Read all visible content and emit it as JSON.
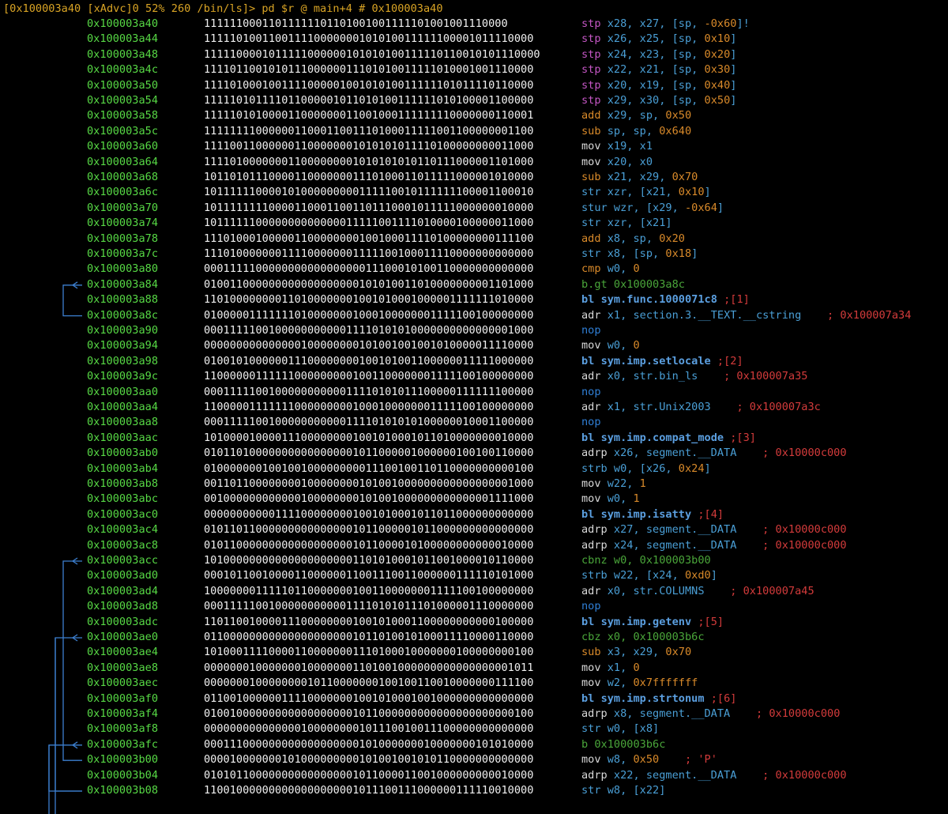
{
  "prompt": "[0x100003a40 [xAdvc]0 52% 260 /bin/ls]> pd $r @ main+4 # 0x100003a40",
  "lines": [
    {
      "addr": "0x100003a40",
      "bits": "11111100011011111101101001001111101001001110000",
      "mn": "stp",
      "mc": "c-stp",
      "ops": [
        [
          "x28, x27, [",
          "reg"
        ],
        [
          "sp",
          "reg"
        ],
        [
          ", ",
          "reg"
        ],
        [
          "-0x60",
          "num"
        ],
        [
          "]!",
          "reg"
        ]
      ]
    },
    {
      "addr": "0x100003a44",
      "bits": "111110100110011110000000101010011111100001011110000",
      "mn": "stp",
      "mc": "c-stp",
      "ops": [
        [
          "x26, x25, [sp, ",
          "reg"
        ],
        [
          "0x10",
          "num"
        ],
        [
          "]",
          "reg"
        ]
      ]
    },
    {
      "addr": "0x100003a48",
      "bits": "111110000101111100000010101010011111011001010111 0000",
      "mn": "stp",
      "mc": "c-stp",
      "ops": [
        [
          "x24, x23, [sp, ",
          "reg"
        ],
        [
          "0x20",
          "num"
        ],
        [
          "]",
          "reg"
        ]
      ]
    },
    {
      "addr": "0x100003a4c",
      "bits": "111101100101011100000011101010011111010001001110000",
      "mn": "stp",
      "mc": "c-stp",
      "ops": [
        [
          "x22, x21, [sp, ",
          "reg"
        ],
        [
          "0x30",
          "num"
        ],
        [
          "]",
          "reg"
        ]
      ]
    },
    {
      "addr": "0x100003a50",
      "bits": "111101000100111100000100101010011111101011110110000",
      "mn": "stp",
      "mc": "c-stp",
      "ops": [
        [
          "x20, x19, [sp, ",
          "reg"
        ],
        [
          "0x40",
          "num"
        ],
        [
          "]",
          "reg"
        ]
      ]
    },
    {
      "addr": "0x100003a54",
      "bits": "111110101111011000001011010100111111010100001100000",
      "mn": "stp",
      "mc": "c-stp",
      "ops": [
        [
          "x29, x30, [sp, ",
          "reg"
        ],
        [
          "0x50",
          "num"
        ],
        [
          "]",
          "reg"
        ]
      ]
    },
    {
      "addr": "0x100003a58",
      "bits": "111110101000011000000011001000111111110000000110001",
      "mn": "add",
      "mc": "c-cmp",
      "ops": [
        [
          "x29, ",
          "reg"
        ],
        [
          "sp",
          "reg"
        ],
        [
          ", ",
          "reg"
        ],
        [
          "0x50",
          "num"
        ]
      ]
    },
    {
      "addr": "0x100003a5c",
      "bits": "111111110000001100011001110100011111001100000001100",
      "mn": "sub",
      "mc": "c-cmp",
      "ops": [
        [
          "sp, sp, ",
          "reg"
        ],
        [
          "0x640",
          "num"
        ]
      ]
    },
    {
      "addr": "0x100003a60",
      "bits": "111100110000001100000001010101011110100000000011000",
      "mn": "mov",
      "mc": "c-mov",
      "ops": [
        [
          "x19, x1",
          "reg"
        ]
      ]
    },
    {
      "addr": "0x100003a64",
      "bits": "111101000000011000000001010101010110111000001101000",
      "mn": "mov",
      "mc": "c-mov",
      "ops": [
        [
          "x20, x0",
          "reg"
        ]
      ]
    },
    {
      "addr": "0x100003a68",
      "bits": "101101011100001100000001110100011011111000001010000",
      "mn": "sub",
      "mc": "c-cmp",
      "ops": [
        [
          "x21, x29, ",
          "reg"
        ],
        [
          "0x70",
          "num"
        ]
      ]
    },
    {
      "addr": "0x100003a6c",
      "bits": "101111110000101000000000111110010111111100001100010",
      "mn": "str",
      "mc": "c-st",
      "ops": [
        [
          "xzr, [x21, ",
          "reg"
        ],
        [
          "0x10",
          "num"
        ],
        [
          "]",
          "reg"
        ]
      ]
    },
    {
      "addr": "0x100003a70",
      "bits": "101111111100001100011001101110001011111000000010000",
      "mn": "stur",
      "mc": "c-st",
      "ops": [
        [
          "wzr, [x29, ",
          "reg"
        ],
        [
          "-0x64",
          "num"
        ],
        [
          "]",
          "reg"
        ]
      ]
    },
    {
      "addr": "0x100003a74",
      "bits": "101111110000000000000011111001111010000100000011000",
      "mn": "str",
      "mc": "c-st",
      "ops": [
        [
          "xzr, [x21]",
          "reg"
        ]
      ]
    },
    {
      "addr": "0x100003a78",
      "bits": "111010001000001100000000100100011110100000000111100",
      "mn": "add",
      "mc": "c-cmp",
      "ops": [
        [
          "x8, sp, ",
          "reg"
        ],
        [
          "0x20",
          "num"
        ]
      ]
    },
    {
      "addr": "0x100003a7c",
      "bits": "111010000000111100000001111100100011110000000000000",
      "mn": "str",
      "mc": "c-st",
      "ops": [
        [
          "x8, [sp, ",
          "reg"
        ],
        [
          "0x18",
          "num"
        ],
        [
          "]",
          "reg"
        ]
      ]
    },
    {
      "addr": "0x100003a80",
      "bits": "000111110000000000000000011100010100110000000000000",
      "mn": "cmp",
      "mc": "c-cmp",
      "ops": [
        [
          "w0, ",
          "reg"
        ],
        [
          "0",
          "num"
        ]
      ]
    },
    {
      "addr": "0x100003a84",
      "bits": "010011000000000000000000101010011010000000001101000",
      "mn": "b.gt",
      "mc": "c-jmp",
      "ops": [
        [
          "0x100003a8c",
          "c-jmp"
        ]
      ]
    },
    {
      "addr": "0x100003a88",
      "bits": "110100000000110100000001001010001000001111111010000",
      "mn": "bl",
      "mc": "c-call",
      "ops": [
        [
          "sym.func.1000071c8",
          "c-call"
        ],
        [
          " ;[1]",
          "ref"
        ]
      ]
    },
    {
      "addr": "0x100003a8c",
      "bits": "010000011111110100000001000100000001111100100000000",
      "mn": "adr",
      "mc": "c-ar",
      "ops": [
        [
          "x1, section.3.__TEXT.__cstring",
          "sym"
        ],
        [
          "    ; 0x100007a34",
          "cmt"
        ]
      ]
    },
    {
      "addr": "0x100003a90",
      "bits": "000111110010000000000011110101010000000000000001000",
      "mn": "nop",
      "mc": "c-nop",
      "ops": []
    },
    {
      "addr": "0x100003a94",
      "bits": "000000000000000100000000101001001001010000011110000",
      "mn": "mov",
      "mc": "c-mov",
      "ops": [
        [
          "w0, ",
          "reg"
        ],
        [
          "0",
          "num"
        ]
      ]
    },
    {
      "addr": "0x100003a98",
      "bits": "010010100000011100000000100101001100000011111000000",
      "mn": "bl",
      "mc": "c-call",
      "ops": [
        [
          "sym.imp.setlocale",
          "c-call"
        ],
        [
          " ;[2]",
          "ref"
        ]
      ]
    },
    {
      "addr": "0x100003a9c",
      "bits": "110000001111110000000001001100000001111100100000000",
      "mn": "adr",
      "mc": "c-ar",
      "ops": [
        [
          "x0, str.bin_ls",
          "sym"
        ],
        [
          "    ; 0x100007a35",
          "cmt"
        ]
      ]
    },
    {
      "addr": "0x100003aa0",
      "bits": "000111110010000000000011110101011100000111111100000",
      "mn": "nop",
      "mc": "c-nop",
      "ops": []
    },
    {
      "addr": "0x100003aa4",
      "bits": "110000011111110000000001000100000001111100100000000",
      "mn": "adr",
      "mc": "c-ar",
      "ops": [
        [
          "x1, str.Unix2003",
          "sym"
        ],
        [
          "    ; 0x100007a3c",
          "cmt"
        ]
      ]
    },
    {
      "addr": "0x100003aa8",
      "bits": "000111110010000000000011110101010100000010001100000",
      "mn": "nop",
      "mc": "c-nop",
      "ops": []
    },
    {
      "addr": "0x100003aac",
      "bits": "101000010000111000000001001010001011010000000010000",
      "mn": "bl",
      "mc": "c-call",
      "ops": [
        [
          "sym.imp.compat_mode",
          "c-call"
        ],
        [
          " ;[3]",
          "ref"
        ]
      ]
    },
    {
      "addr": "0x100003ab0",
      "bits": "010110100000000000000001011000001000000100100110000",
      "mn": "adrp",
      "mc": "c-ar",
      "ops": [
        [
          "x26, segment.__DATA",
          "sym"
        ],
        [
          "    ; 0x10000c000",
          "cmt"
        ]
      ]
    },
    {
      "addr": "0x100003ab4",
      "bits": "010000000100100100000000011100100110110000000000100",
      "mn": "strb",
      "mc": "c-st",
      "ops": [
        [
          "w0, [x26, ",
          "reg"
        ],
        [
          "0x24",
          "num"
        ],
        [
          "]",
          "reg"
        ]
      ]
    },
    {
      "addr": "0x100003ab8",
      "bits": "001101100000000100000000101001000000000000000001000",
      "mn": "mov",
      "mc": "c-mov",
      "ops": [
        [
          "w22, ",
          "reg"
        ],
        [
          "1",
          "num"
        ]
      ]
    },
    {
      "addr": "0x100003abc",
      "bits": "001000000000000100000000101001000000000000001111000",
      "mn": "mov",
      "mc": "c-mov",
      "ops": [
        [
          "w0, ",
          "reg"
        ],
        [
          "1",
          "num"
        ]
      ]
    },
    {
      "addr": "0x100003ac0",
      "bits": "000000000001111000000001001010001011011000000000000",
      "mn": "bl",
      "mc": "c-call",
      "ops": [
        [
          "sym.imp.isatty",
          "c-call"
        ],
        [
          " ;[4]",
          "ref"
        ]
      ]
    },
    {
      "addr": "0x100003ac4",
      "bits": "010110110000000000000001011000001011000000000000000",
      "mn": "adrp",
      "mc": "c-ar",
      "ops": [
        [
          "x27, segment.__DATA",
          "sym"
        ],
        [
          "    ; 0x10000c000",
          "cmt"
        ]
      ]
    },
    {
      "addr": "0x100003ac8",
      "bits": "010110000000000000000001011000010100000000000010000",
      "mn": "adrp",
      "mc": "c-ar",
      "ops": [
        [
          "x24, segment.__DATA",
          "sym"
        ],
        [
          "    ; 0x10000c000",
          "cmt"
        ]
      ]
    },
    {
      "addr": "0x100003acc",
      "bits": "101000000000000000000001101010001011001000010110000",
      "mn": "cbnz",
      "mc": "c-jmp",
      "ops": [
        [
          "w0, 0x100003b00",
          "c-jmp"
        ]
      ]
    },
    {
      "addr": "0x100003ad0",
      "bits": "000101100100001100000011001110011000000111110101000",
      "mn": "strb",
      "mc": "c-st",
      "ops": [
        [
          "w22, [x24, ",
          "reg"
        ],
        [
          "0xd0",
          "num"
        ],
        [
          "]",
          "reg"
        ]
      ]
    },
    {
      "addr": "0x100003ad4",
      "bits": "100000001111101100000001001100000001111100100000000",
      "mn": "adr",
      "mc": "c-ar",
      "ops": [
        [
          "x0, str.COLUMNS",
          "sym"
        ],
        [
          "    ; 0x100007a45",
          "cmt"
        ]
      ]
    },
    {
      "addr": "0x100003ad8",
      "bits": "000111110010000000000011110101011101000001110000000",
      "mn": "nop",
      "mc": "c-nop",
      "ops": []
    },
    {
      "addr": "0x100003adc",
      "bits": "110110010000111000000001001010001100000000000100000",
      "mn": "bl",
      "mc": "c-call",
      "ops": [
        [
          "sym.imp.getenv",
          "c-call"
        ],
        [
          " ;[5]",
          "ref"
        ]
      ]
    },
    {
      "addr": "0x100003ae0",
      "bits": "011000000000000000000001011010010100011110000110000",
      "mn": "cbz",
      "mc": "c-jmp",
      "ops": [
        [
          "x0, 0x100003b6c",
          "c-jmp"
        ]
      ]
    },
    {
      "addr": "0x100003ae4",
      "bits": "101000111100001100000001110100010000000100000000100",
      "mn": "sub",
      "mc": "c-cmp",
      "ops": [
        [
          "x3, x29, ",
          "reg"
        ],
        [
          "0x70",
          "num"
        ]
      ]
    },
    {
      "addr": "0x100003ae8",
      "bits": "000000010000000100000001101001000000000000000001011",
      "mn": "mov",
      "mc": "c-mov",
      "ops": [
        [
          "x1, ",
          "reg"
        ],
        [
          "0",
          "num"
        ]
      ]
    },
    {
      "addr": "0x100003aec",
      "bits": "000000010000000010110000000100100110010000000111100",
      "mn": "mov",
      "mc": "c-mov",
      "ops": [
        [
          "w2, ",
          "reg"
        ],
        [
          "0x7fffffff",
          "num"
        ]
      ]
    },
    {
      "addr": "0x100003af0",
      "bits": "011001000000111100000001001010001001000000000000000",
      "mn": "bl",
      "mc": "c-call",
      "ops": [
        [
          "sym.imp.strtonum",
          "c-call"
        ],
        [
          " ;[6]",
          "ref"
        ]
      ]
    },
    {
      "addr": "0x100003af4",
      "bits": "010010000000000000000001011000000000000000000000100",
      "mn": "adrp",
      "mc": "c-ar",
      "ops": [
        [
          "x8, segment.__DATA",
          "sym"
        ],
        [
          "    ; 0x10000c000",
          "cmt"
        ]
      ]
    },
    {
      "addr": "0x100003af8",
      "bits": "000000000000000100000000101110010011100000000000000",
      "mn": "str",
      "mc": "c-st",
      "ops": [
        [
          "w0, [x8]",
          "reg"
        ]
      ]
    },
    {
      "addr": "0x100003afc",
      "bits": "000111000000000000000000101000000010000000101010000",
      "mn": "b",
      "mc": "c-jmp",
      "ops": [
        [
          "0x100003b6c",
          "c-jmp"
        ]
      ]
    },
    {
      "addr": "0x100003b00",
      "bits": "000010000000101000000000101001001010110000000000000",
      "mn": "mov",
      "mc": "c-mov",
      "ops": [
        [
          "w8, ",
          "reg"
        ],
        [
          "0x50",
          "num"
        ],
        [
          "    ; 'P'",
          "cmt"
        ]
      ]
    },
    {
      "addr": "0x100003b04",
      "bits": "010101100000000000000001011000011001000000000010000",
      "mn": "adrp",
      "mc": "c-ar",
      "ops": [
        [
          "x22, segment.__DATA",
          "sym"
        ],
        [
          "    ; 0x10000c000",
          "cmt"
        ]
      ]
    },
    {
      "addr": "0x100003b08",
      "bits": "110010000000000000000001011100111000000111110010000",
      "mn": "str",
      "mc": "c-st",
      "ops": [
        [
          "w8, [x22]",
          "reg"
        ]
      ]
    }
  ]
}
